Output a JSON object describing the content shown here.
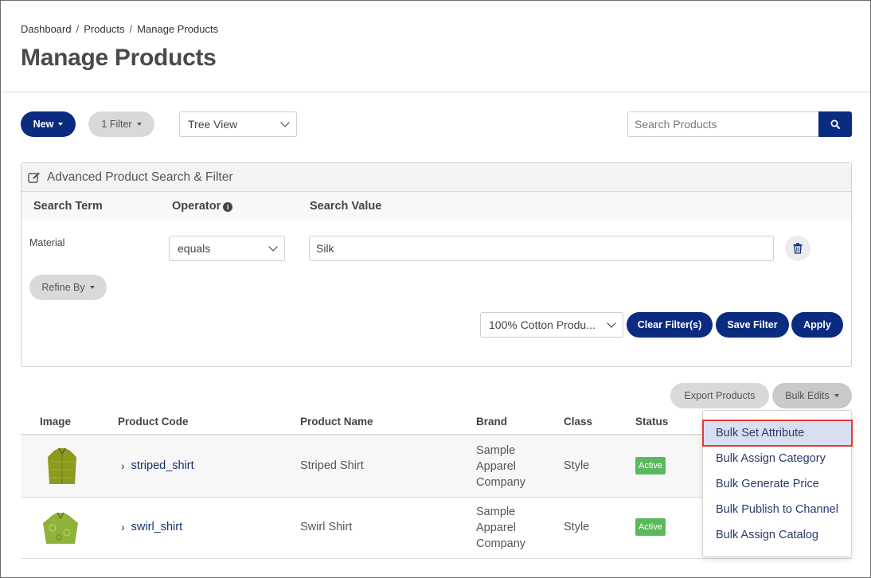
{
  "breadcrumb": [
    "Dashboard",
    "Products",
    "Manage Products"
  ],
  "breadcrumb_sep": "/",
  "page_title": "Manage Products",
  "toolbar": {
    "new_label": "New",
    "filter_label": "1 Filter",
    "view_select": "Tree View",
    "search_placeholder": "Search Products"
  },
  "advanced": {
    "title": "Advanced Product Search & Filter",
    "col_term": "Search Term",
    "col_operator": "Operator",
    "col_value": "Search Value",
    "row_term": "Material",
    "row_operator": "equals",
    "row_value": "Silk",
    "refine_label": "Refine By",
    "saved_filter": "100% Cotton Produ...",
    "clear_label": "Clear Filter(s)",
    "save_label": "Save Filter",
    "apply_label": "Apply"
  },
  "actions": {
    "export_label": "Export Products",
    "bulk_label": "Bulk Edits"
  },
  "table": {
    "headers": [
      "Image",
      "Product Code",
      "Product Name",
      "Brand",
      "Class",
      "Status"
    ],
    "rows": [
      {
        "code": "striped_shirt",
        "name": "Striped Shirt",
        "brand": [
          "Sample",
          "Apparel",
          "Company"
        ],
        "class": "Style",
        "status": "Active",
        "thumb_color": "#8c9a1e"
      },
      {
        "code": "swirl_shirt",
        "name": "Swirl Shirt",
        "brand": [
          "Sample",
          "Apparel",
          "Company"
        ],
        "class": "Style",
        "status": "Active",
        "thumb_color": "#8fb23a"
      }
    ]
  },
  "bulk_menu": [
    "Bulk Set Attribute",
    "Bulk Assign Category",
    "Bulk Generate Price",
    "Bulk Publish to Channel",
    "Bulk Assign Catalog"
  ],
  "colors": {
    "primary": "#0b2b80",
    "success": "#5cb85c",
    "highlight_border": "#e53935"
  }
}
